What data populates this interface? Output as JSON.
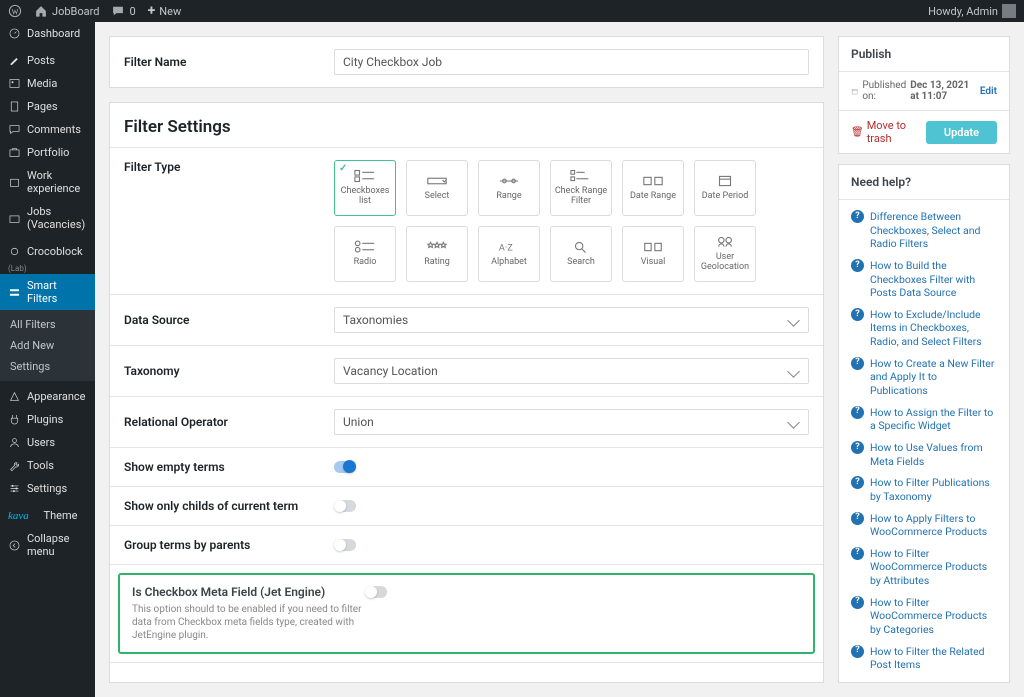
{
  "adminbar": {
    "site_name": "JobBoard",
    "comments": "0",
    "new": "New",
    "howdy": "Howdy, Admin"
  },
  "sidebar": {
    "items": [
      {
        "label": "Dashboard"
      },
      {
        "label": "Posts"
      },
      {
        "label": "Media"
      },
      {
        "label": "Pages"
      },
      {
        "label": "Comments"
      },
      {
        "label": "Portfolio"
      },
      {
        "label": "Work experience"
      },
      {
        "label": "Jobs (Vacancies)"
      },
      {
        "label": "Crocoblock"
      },
      {
        "label": "Smart Filters"
      },
      {
        "label": "Appearance"
      },
      {
        "label": "Plugins"
      },
      {
        "label": "Users"
      },
      {
        "label": "Tools"
      },
      {
        "label": "Settings"
      },
      {
        "label": "Theme"
      },
      {
        "label": "Collapse menu"
      }
    ],
    "sub": {
      "all_filters": "All Filters",
      "add_new": "Add New",
      "settings": "Settings"
    }
  },
  "filter": {
    "name_label": "Filter Name",
    "name_value": "City Checkbox Job",
    "settings_title": "Filter Settings",
    "type_label": "Filter Type",
    "types": [
      "Checkboxes list",
      "Select",
      "Range",
      "Check Range Filter",
      "Date Range",
      "Date Period",
      "Radio",
      "Rating",
      "Alphabet",
      "Search",
      "Visual",
      "User Geolocation"
    ],
    "data_source_label": "Data Source",
    "data_source_value": "Taxonomies",
    "taxonomy_label": "Taxonomy",
    "taxonomy_value": "Vacancy Location",
    "rel_op_label": "Relational Operator",
    "rel_op_value": "Union",
    "show_empty_label": "Show empty terms",
    "show_childs_label": "Show only childs of current term",
    "group_parents_label": "Group terms by parents",
    "meta_field_label": "Is Checkbox Meta Field (Jet Engine)",
    "meta_field_desc": "This option should to be enabled if you need to filter data from Checkbox meta fields type, created with JetEngine plugin."
  },
  "publish": {
    "title": "Publish",
    "published_on": "Published on:",
    "date": "Dec 13, 2021 at 11:07",
    "edit": "Edit",
    "trash": "Move to trash",
    "update": "Update"
  },
  "help": {
    "title": "Need help?",
    "items": [
      "Difference Between Checkboxes, Select and Radio Filters",
      "How to Build the Checkboxes Filter with Posts Data Source",
      "How to Exclude/Include Items in Checkboxes, Radio, and Select Filters",
      "How to Create a New Filter and Apply It to Publications",
      "How to Assign the Filter to a Specific Widget",
      "How to Use Values from Meta Fields",
      "How to Filter Publications by Taxonomy",
      "How to Apply Filters to WooCommerce Products",
      "How to Filter WooCommerce Products by Attributes",
      "How to Filter WooCommerce Products by Categories",
      "How to Filter the Related Post Items"
    ]
  }
}
